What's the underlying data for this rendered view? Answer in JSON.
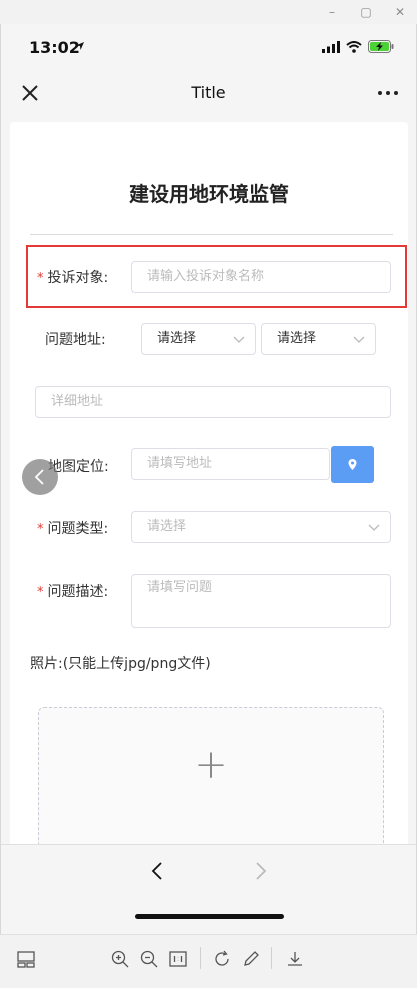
{
  "status_bar": {
    "time": "13:02"
  },
  "navbar": {
    "title": "Title"
  },
  "form": {
    "title": "建设用地环境监管",
    "required_mark": "*",
    "complaint_target": {
      "label": "投诉对象:",
      "placeholder": "请输入投诉对象名称"
    },
    "problem_address": {
      "label": "问题地址:",
      "select1": "请选择",
      "select2": "请选择",
      "detail_placeholder": "详细地址"
    },
    "map_location": {
      "label": "地图定位:",
      "placeholder": "请填写地址"
    },
    "problem_type": {
      "label": "问题类型:",
      "placeholder": "请选择"
    },
    "problem_description": {
      "label": "问题描述:",
      "placeholder": "请填写问题"
    },
    "photos": {
      "label": "照片:(只能上传jpg/png文件)",
      "add_glyph": "+"
    }
  },
  "colors": {
    "required": "#e53935",
    "highlight_border": "#e53935",
    "location_button": "#5b9cf5"
  },
  "toolbar_icons": [
    "layout-icon",
    "zoom-in-icon",
    "zoom-out-icon",
    "actual-size-icon",
    "rotate-icon",
    "edit-icon",
    "download-icon"
  ]
}
